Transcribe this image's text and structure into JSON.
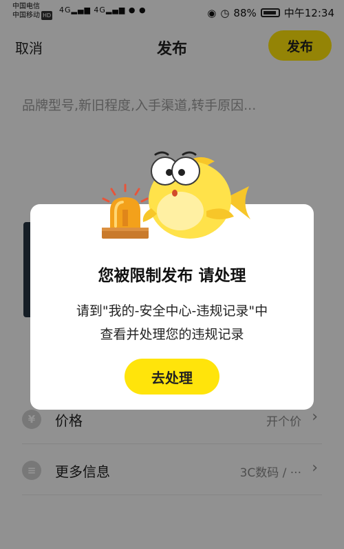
{
  "status_bar": {
    "carrier_1": "中国电信",
    "carrier_2": "中国移动",
    "hd_badge": "HD",
    "signal_1": "4G",
    "signal_2": "4G",
    "battery_percent": "88%",
    "time": "中午12:34"
  },
  "header": {
    "cancel_label": "取消",
    "title": "发布",
    "publish_label": "发布"
  },
  "description": {
    "placeholder": "品牌型号,新旧程度,入手渠道,转手原因..."
  },
  "list": {
    "items": [
      {
        "icon": "yen-icon",
        "label": "价格",
        "value": "开个价"
      },
      {
        "icon": "more-info-icon",
        "label": "更多信息",
        "value": "3C数码 / ···"
      }
    ]
  },
  "dialog": {
    "title": "您被限制发布 请处理",
    "message_line1": "请到\"我的-安全中心-违规记录\"中",
    "message_line2": "查看并处理您的违规记录",
    "action_label": "去处理"
  },
  "colors": {
    "accent": "#ffe40b",
    "overlay": "rgba(0,0,0,0.42)"
  }
}
